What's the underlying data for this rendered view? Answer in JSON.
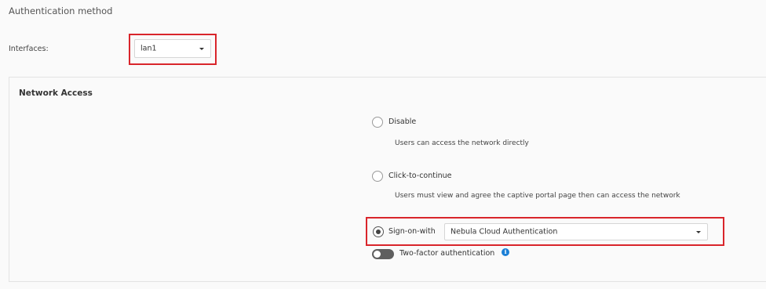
{
  "section_title": "Authentication method",
  "interfaces": {
    "label": "Interfaces:",
    "value": "lan1"
  },
  "network_access": {
    "title": "Network Access",
    "options": [
      {
        "label": "Disable",
        "description": "Users can access the network directly",
        "selected": false
      },
      {
        "label": "Click-to-continue",
        "description": "Users must view and agree the captive portal page then can access the network",
        "selected": false
      },
      {
        "label": "Sign-on-with",
        "selected": true,
        "select_value": "Nebula Cloud Authentication"
      }
    ],
    "two_factor": {
      "label": "Two-factor authentication",
      "enabled": false,
      "info_icon": "i"
    }
  },
  "colors": {
    "highlight": "#d9252b",
    "info": "#1b7fd6"
  }
}
